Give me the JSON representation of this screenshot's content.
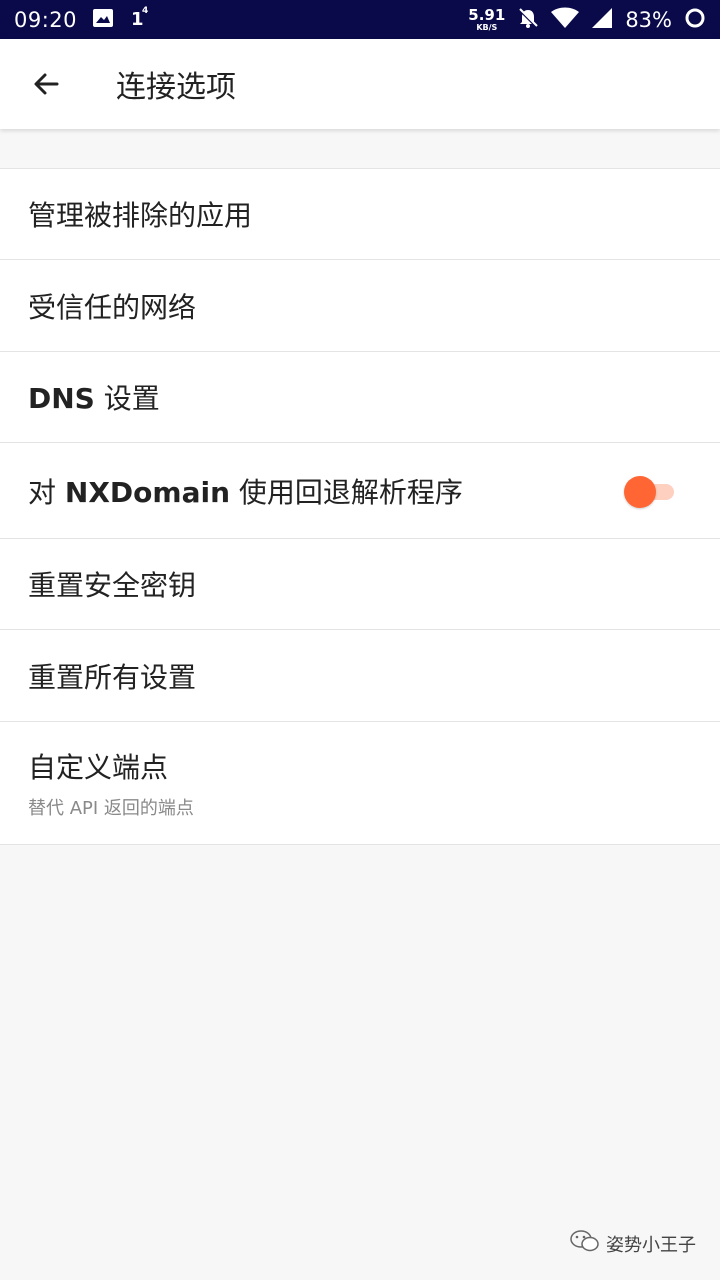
{
  "status_bar": {
    "time": "09:20",
    "net_speed_value": "5.91",
    "net_speed_unit": "KB/S",
    "battery": "83%",
    "up_indicator": "1",
    "up_indicator_sup": "4"
  },
  "app_bar": {
    "title": "连接选项"
  },
  "items": [
    {
      "label": "管理被排除的应用"
    },
    {
      "label": "受信任的网络"
    },
    {
      "label_bold": "DNS",
      "label_rest": " 设置"
    },
    {
      "label_pre": "对 ",
      "label_bold": "NXDomain",
      "label_post": " 使用回退解析程序",
      "toggle_on": true
    },
    {
      "label": "重置安全密钥"
    },
    {
      "label": "重置所有设置"
    },
    {
      "label": "自定义端点",
      "sub": "替代 API 返回的端点"
    }
  ],
  "watermark": {
    "text": "姿势小王子"
  },
  "colors": {
    "status_bar": "#0a0a4a",
    "accent": "#ff6633"
  }
}
